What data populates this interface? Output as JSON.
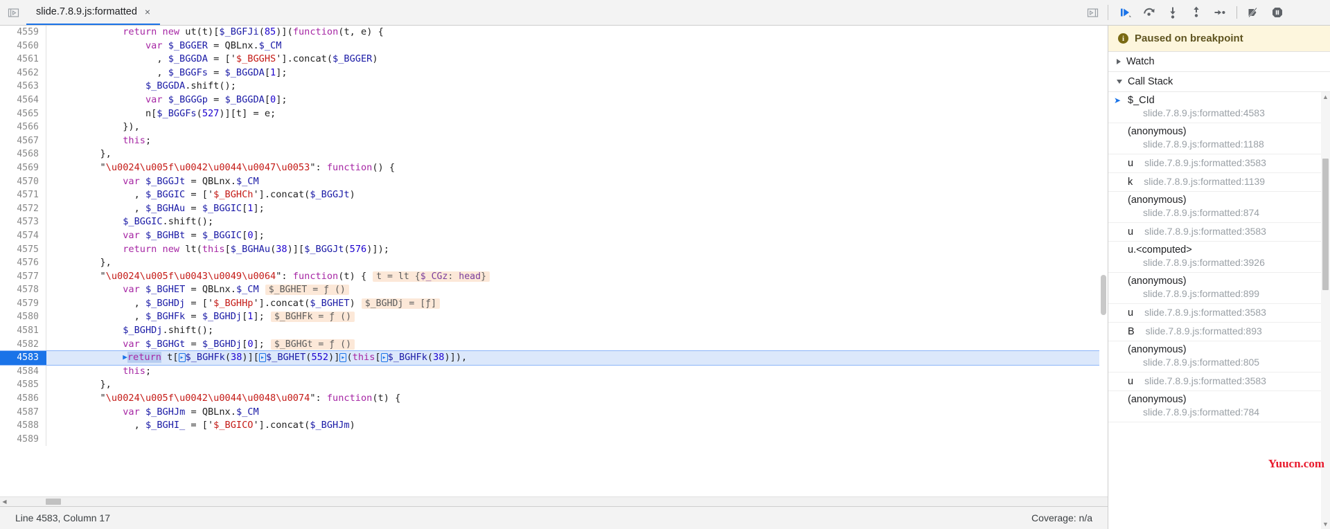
{
  "window": {
    "panel_toggle_icon": "dock-to-left-icon",
    "sidebar_toggle_icon": "show-navigator-icon"
  },
  "tabs": [
    {
      "label": "slide.7.8.9.js:formatted",
      "close_label": "×",
      "active": true
    }
  ],
  "debug_toolbar": {
    "buttons": [
      {
        "name": "resume-script-execution",
        "label": "Resume script execution"
      },
      {
        "name": "step-over-next-function-call",
        "label": "Step over next function call"
      },
      {
        "name": "step-into-next-function-call",
        "label": "Step into next function call"
      },
      {
        "name": "step-out-of-current-function",
        "label": "Step out of current function"
      },
      {
        "name": "step",
        "label": "Step"
      },
      {
        "name": "deactivate-breakpoints",
        "label": "Deactivate breakpoints"
      },
      {
        "name": "pause-on-exceptions",
        "label": "Pause on exceptions"
      }
    ]
  },
  "editor": {
    "execution_line": 4583,
    "lines": [
      {
        "n": "4559",
        "tokens": [
          {
            "t": "            ",
            "c": "plain"
          },
          {
            "t": "return",
            "c": "kw"
          },
          {
            "t": " ",
            "c": "plain"
          },
          {
            "t": "new",
            "c": "kw"
          },
          {
            "t": " ut(",
            "c": "plain"
          },
          {
            "t": "t",
            "c": "plain"
          },
          {
            "t": ")[",
            "c": "plain"
          },
          {
            "t": "$_BGFJi",
            "c": "var"
          },
          {
            "t": "(",
            "c": "plain"
          },
          {
            "t": "85",
            "c": "num"
          },
          {
            "t": ")](",
            "c": "plain"
          },
          {
            "t": "function",
            "c": "kw"
          },
          {
            "t": "(t, e) {",
            "c": "plain"
          }
        ]
      },
      {
        "n": "4560",
        "tokens": [
          {
            "t": "                ",
            "c": "plain"
          },
          {
            "t": "var",
            "c": "kw"
          },
          {
            "t": " ",
            "c": "plain"
          },
          {
            "t": "$_BGGER",
            "c": "var"
          },
          {
            "t": " = QBLnx.",
            "c": "plain"
          },
          {
            "t": "$_CM",
            "c": "var"
          }
        ]
      },
      {
        "n": "4561",
        "tokens": [
          {
            "t": "                  , ",
            "c": "plain"
          },
          {
            "t": "$_BGGDA",
            "c": "var"
          },
          {
            "t": " = ['",
            "c": "plain"
          },
          {
            "t": "$_BGGHS",
            "c": "str"
          },
          {
            "t": "'].concat(",
            "c": "plain"
          },
          {
            "t": "$_BGGER",
            "c": "var"
          },
          {
            "t": ")",
            "c": "plain"
          }
        ]
      },
      {
        "n": "4562",
        "tokens": [
          {
            "t": "                  , ",
            "c": "plain"
          },
          {
            "t": "$_BGGFs",
            "c": "var"
          },
          {
            "t": " = ",
            "c": "plain"
          },
          {
            "t": "$_BGGDA",
            "c": "var"
          },
          {
            "t": "[",
            "c": "plain"
          },
          {
            "t": "1",
            "c": "num"
          },
          {
            "t": "];",
            "c": "plain"
          }
        ]
      },
      {
        "n": "4563",
        "tokens": [
          {
            "t": "                ",
            "c": "plain"
          },
          {
            "t": "$_BGGDA",
            "c": "var"
          },
          {
            "t": ".shift();",
            "c": "plain"
          }
        ]
      },
      {
        "n": "4564",
        "tokens": [
          {
            "t": "                ",
            "c": "plain"
          },
          {
            "t": "var",
            "c": "kw"
          },
          {
            "t": " ",
            "c": "plain"
          },
          {
            "t": "$_BGGGp",
            "c": "var"
          },
          {
            "t": " = ",
            "c": "plain"
          },
          {
            "t": "$_BGGDA",
            "c": "var"
          },
          {
            "t": "[",
            "c": "plain"
          },
          {
            "t": "0",
            "c": "num"
          },
          {
            "t": "];",
            "c": "plain"
          }
        ]
      },
      {
        "n": "4565",
        "tokens": [
          {
            "t": "                n[",
            "c": "plain"
          },
          {
            "t": "$_BGGFs",
            "c": "var"
          },
          {
            "t": "(",
            "c": "plain"
          },
          {
            "t": "527",
            "c": "num"
          },
          {
            "t": ")][t] = e;",
            "c": "plain"
          }
        ]
      },
      {
        "n": "4566",
        "tokens": [
          {
            "t": "            }),",
            "c": "plain"
          }
        ]
      },
      {
        "n": "4567",
        "tokens": [
          {
            "t": "            ",
            "c": "plain"
          },
          {
            "t": "this",
            "c": "kw"
          },
          {
            "t": ";",
            "c": "plain"
          }
        ]
      },
      {
        "n": "4568",
        "tokens": [
          {
            "t": "        },",
            "c": "plain"
          }
        ]
      },
      {
        "n": "4569",
        "tokens": [
          {
            "t": "        \"",
            "c": "plain"
          },
          {
            "t": "\\u0024\\u005f\\u0042\\u0044\\u0047\\u0053",
            "c": "esc"
          },
          {
            "t": "\": ",
            "c": "plain"
          },
          {
            "t": "function",
            "c": "kw"
          },
          {
            "t": "() {",
            "c": "plain"
          }
        ]
      },
      {
        "n": "4570",
        "tokens": [
          {
            "t": "            ",
            "c": "plain"
          },
          {
            "t": "var",
            "c": "kw"
          },
          {
            "t": " ",
            "c": "plain"
          },
          {
            "t": "$_BGGJt",
            "c": "var"
          },
          {
            "t": " = QBLnx.",
            "c": "plain"
          },
          {
            "t": "$_CM",
            "c": "var"
          }
        ]
      },
      {
        "n": "4571",
        "tokens": [
          {
            "t": "              , ",
            "c": "plain"
          },
          {
            "t": "$_BGGIC",
            "c": "var"
          },
          {
            "t": " = ['",
            "c": "plain"
          },
          {
            "t": "$_BGHCh",
            "c": "str"
          },
          {
            "t": "'].concat(",
            "c": "plain"
          },
          {
            "t": "$_BGGJt",
            "c": "var"
          },
          {
            "t": ")",
            "c": "plain"
          }
        ]
      },
      {
        "n": "4572",
        "tokens": [
          {
            "t": "              , ",
            "c": "plain"
          },
          {
            "t": "$_BGHAu",
            "c": "var"
          },
          {
            "t": " = ",
            "c": "plain"
          },
          {
            "t": "$_BGGIC",
            "c": "var"
          },
          {
            "t": "[",
            "c": "plain"
          },
          {
            "t": "1",
            "c": "num"
          },
          {
            "t": "];",
            "c": "plain"
          }
        ]
      },
      {
        "n": "4573",
        "tokens": [
          {
            "t": "            ",
            "c": "plain"
          },
          {
            "t": "$_BGGIC",
            "c": "var"
          },
          {
            "t": ".shift();",
            "c": "plain"
          }
        ]
      },
      {
        "n": "4574",
        "tokens": [
          {
            "t": "            ",
            "c": "plain"
          },
          {
            "t": "var",
            "c": "kw"
          },
          {
            "t": " ",
            "c": "plain"
          },
          {
            "t": "$_BGHBt",
            "c": "var"
          },
          {
            "t": " = ",
            "c": "plain"
          },
          {
            "t": "$_BGGIC",
            "c": "var"
          },
          {
            "t": "[",
            "c": "plain"
          },
          {
            "t": "0",
            "c": "num"
          },
          {
            "t": "];",
            "c": "plain"
          }
        ]
      },
      {
        "n": "4575",
        "tokens": [
          {
            "t": "            ",
            "c": "plain"
          },
          {
            "t": "return",
            "c": "kw"
          },
          {
            "t": " ",
            "c": "plain"
          },
          {
            "t": "new",
            "c": "kw"
          },
          {
            "t": " lt(",
            "c": "plain"
          },
          {
            "t": "this",
            "c": "kw"
          },
          {
            "t": "[",
            "c": "plain"
          },
          {
            "t": "$_BGHAu",
            "c": "var"
          },
          {
            "t": "(",
            "c": "plain"
          },
          {
            "t": "38",
            "c": "num"
          },
          {
            "t": ")][",
            "c": "plain"
          },
          {
            "t": "$_BGGJt",
            "c": "var"
          },
          {
            "t": "(",
            "c": "plain"
          },
          {
            "t": "576",
            "c": "num"
          },
          {
            "t": ")]);",
            "c": "plain"
          }
        ]
      },
      {
        "n": "4576",
        "tokens": [
          {
            "t": "        },",
            "c": "plain"
          }
        ]
      },
      {
        "n": "4577",
        "tokens": [
          {
            "t": "        \"",
            "c": "plain"
          },
          {
            "t": "\\u0024\\u005f\\u0043\\u0049\\u0064",
            "c": "esc"
          },
          {
            "t": "\": ",
            "c": "plain"
          },
          {
            "t": "function",
            "c": "kw"
          },
          {
            "t": "(t) {",
            "c": "plain"
          }
        ],
        "hint": {
          "prefix": "t = lt {",
          "key": "$_CGz",
          "sep": ": ",
          "val": "head",
          "suffix": "}"
        }
      },
      {
        "n": "4578",
        "tokens": [
          {
            "t": "            ",
            "c": "plain"
          },
          {
            "t": "var",
            "c": "kw"
          },
          {
            "t": " ",
            "c": "plain"
          },
          {
            "t": "$_BGHET",
            "c": "var"
          },
          {
            "t": " = QBLnx.",
            "c": "plain"
          },
          {
            "t": "$_CM",
            "c": "var"
          }
        ],
        "hint_simple": "$_BGHET = ƒ ()"
      },
      {
        "n": "4579",
        "tokens": [
          {
            "t": "              , ",
            "c": "plain"
          },
          {
            "t": "$_BGHDj",
            "c": "var"
          },
          {
            "t": " = ['",
            "c": "plain"
          },
          {
            "t": "$_BGHHp",
            "c": "str"
          },
          {
            "t": "'].concat(",
            "c": "plain"
          },
          {
            "t": "$_BGHET",
            "c": "var"
          },
          {
            "t": ")",
            "c": "plain"
          }
        ],
        "hint_simple": "$_BGHDj = [ƒ]"
      },
      {
        "n": "4580",
        "tokens": [
          {
            "t": "              , ",
            "c": "plain"
          },
          {
            "t": "$_BGHFk",
            "c": "var"
          },
          {
            "t": " = ",
            "c": "plain"
          },
          {
            "t": "$_BGHDj",
            "c": "var"
          },
          {
            "t": "[",
            "c": "plain"
          },
          {
            "t": "1",
            "c": "num"
          },
          {
            "t": "];",
            "c": "plain"
          }
        ],
        "hint_simple": "$_BGHFk = ƒ ()"
      },
      {
        "n": "4581",
        "tokens": [
          {
            "t": "            ",
            "c": "plain"
          },
          {
            "t": "$_BGHDj",
            "c": "var"
          },
          {
            "t": ".shift();",
            "c": "plain"
          }
        ]
      },
      {
        "n": "4582",
        "tokens": [
          {
            "t": "            ",
            "c": "plain"
          },
          {
            "t": "var",
            "c": "kw"
          },
          {
            "t": " ",
            "c": "plain"
          },
          {
            "t": "$_BGHGt",
            "c": "var"
          },
          {
            "t": " = ",
            "c": "plain"
          },
          {
            "t": "$_BGHDj",
            "c": "var"
          },
          {
            "t": "[",
            "c": "plain"
          },
          {
            "t": "0",
            "c": "num"
          },
          {
            "t": "];",
            "c": "plain"
          }
        ],
        "hint_simple": "$_BGHGt = ƒ ()"
      },
      {
        "n": "4583",
        "exec": true,
        "text": "return t[$_BGHFk(38)][$_BGHET(552)](this[$_BGHFk(38)]),"
      },
      {
        "n": "4584",
        "tokens": [
          {
            "t": "            ",
            "c": "plain"
          },
          {
            "t": "this",
            "c": "kw"
          },
          {
            "t": ";",
            "c": "plain"
          }
        ]
      },
      {
        "n": "4585",
        "tokens": [
          {
            "t": "        },",
            "c": "plain"
          }
        ]
      },
      {
        "n": "4586",
        "tokens": [
          {
            "t": "        \"",
            "c": "plain"
          },
          {
            "t": "\\u0024\\u005f\\u0042\\u0044\\u0048\\u0074",
            "c": "esc"
          },
          {
            "t": "\": ",
            "c": "plain"
          },
          {
            "t": "function",
            "c": "kw"
          },
          {
            "t": "(t) {",
            "c": "plain"
          }
        ]
      },
      {
        "n": "4587",
        "tokens": [
          {
            "t": "            ",
            "c": "plain"
          },
          {
            "t": "var",
            "c": "kw"
          },
          {
            "t": " ",
            "c": "plain"
          },
          {
            "t": "$_BGHJm",
            "c": "var"
          },
          {
            "t": " = QBLnx.",
            "c": "plain"
          },
          {
            "t": "$_CM",
            "c": "var"
          }
        ]
      },
      {
        "n": "4588",
        "tokens": [
          {
            "t": "              , ",
            "c": "plain"
          },
          {
            "t": "$_BGHI_",
            "c": "var"
          },
          {
            "t": " = ['",
            "c": "plain"
          },
          {
            "t": "$_BGICO",
            "c": "str"
          },
          {
            "t": "'].concat(",
            "c": "plain"
          },
          {
            "t": "$_BGHJm",
            "c": "var"
          },
          {
            "t": ")",
            "c": "plain"
          }
        ]
      },
      {
        "n": "4589",
        "tokens": []
      }
    ]
  },
  "statusbar": {
    "position": "Line 4583, Column 17",
    "coverage": "Coverage: n/a"
  },
  "sidebar": {
    "paused_banner": {
      "text": "Paused on breakpoint",
      "icon": "info-icon"
    },
    "watch": {
      "label": "Watch",
      "expanded": false
    },
    "call_stack": {
      "label": "Call Stack",
      "expanded": true
    },
    "frames": [
      {
        "name": "$_CId",
        "location": "slide.7.8.9.js:formatted:4583",
        "selected": true,
        "layout": "stacked"
      },
      {
        "name": "(anonymous)",
        "location": "slide.7.8.9.js:formatted:1188",
        "selected": false,
        "layout": "stacked"
      },
      {
        "name": "u",
        "location": "slide.7.8.9.js:formatted:3583",
        "selected": false,
        "layout": "inline"
      },
      {
        "name": "k",
        "location": "slide.7.8.9.js:formatted:1139",
        "selected": false,
        "layout": "inline"
      },
      {
        "name": "(anonymous)",
        "location": "slide.7.8.9.js:formatted:874",
        "selected": false,
        "layout": "stacked"
      },
      {
        "name": "u",
        "location": "slide.7.8.9.js:formatted:3583",
        "selected": false,
        "layout": "inline"
      },
      {
        "name": "u.<computed>",
        "location": "slide.7.8.9.js:formatted:3926",
        "selected": false,
        "layout": "stacked"
      },
      {
        "name": "(anonymous)",
        "location": "slide.7.8.9.js:formatted:899",
        "selected": false,
        "layout": "stacked"
      },
      {
        "name": "u",
        "location": "slide.7.8.9.js:formatted:3583",
        "selected": false,
        "layout": "inline"
      },
      {
        "name": "B",
        "location": "slide.7.8.9.js:formatted:893",
        "selected": false,
        "layout": "inline"
      },
      {
        "name": "(anonymous)",
        "location": "slide.7.8.9.js:formatted:805",
        "selected": false,
        "layout": "stacked"
      },
      {
        "name": "u",
        "location": "slide.7.8.9.js:formatted:3583",
        "selected": false,
        "layout": "inline"
      },
      {
        "name": "(anonymous)",
        "location": "slide.7.8.9.js:formatted:784",
        "selected": false,
        "layout": "stacked"
      }
    ]
  },
  "watermark": {
    "text": "Yuucn.com",
    "color": "#e8192c"
  },
  "colors": {
    "accent": "#1a73e8",
    "exec_line_bg": "#dce8fb",
    "paused_bg": "#fdf6dd",
    "hint_bg": "#fce8d8",
    "string": "#c41a16",
    "keyword": "#a626a4",
    "variable": "#1a1aa6",
    "number": "#1c00cf"
  }
}
